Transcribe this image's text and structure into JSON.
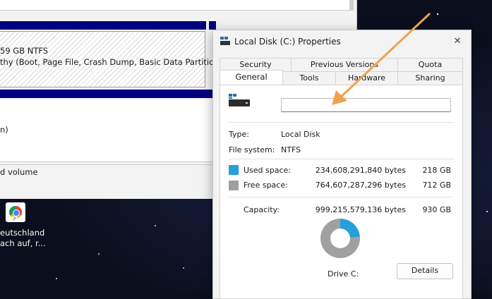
{
  "disk_management": {
    "partition_line1": "59 GB NTFS",
    "partition_line2": "thy (Boot, Page File, Crash Dump, Basic Data Partition)",
    "row2_text": "n)",
    "legend_text": "d volume"
  },
  "desktop_icon": {
    "icon": "chrome-shortcut-icon",
    "label_line1": "eutschland",
    "label_line2": "ach auf, r..."
  },
  "dialog": {
    "title": "Local Disk (C:) Properties",
    "close_glyph": "✕",
    "tabs_row1": [
      "Security",
      "Previous Versions",
      "Quota"
    ],
    "tabs_row2": [
      "General",
      "Tools",
      "Hardware",
      "Sharing"
    ],
    "active_tab": "General",
    "name_field_value": "",
    "type_label": "Type:",
    "type_value": "Local Disk",
    "fs_label": "File system:",
    "fs_value": "NTFS",
    "used_label": "Used space:",
    "used_bytes": "234,608,291,840 bytes",
    "used_gb": "218 GB",
    "free_label": "Free space:",
    "free_bytes": "764,607,287,296 bytes",
    "free_gb": "712 GB",
    "capacity_label": "Capacity:",
    "capacity_bytes": "999,215,579,136 bytes",
    "capacity_gb": "930 GB",
    "drive_label": "Drive C:",
    "details_label": "Details",
    "used_fraction": 0.2348,
    "colors": {
      "used": "#26a0da",
      "free": "#a0a0a0",
      "arrow": "#f0a050"
    }
  }
}
